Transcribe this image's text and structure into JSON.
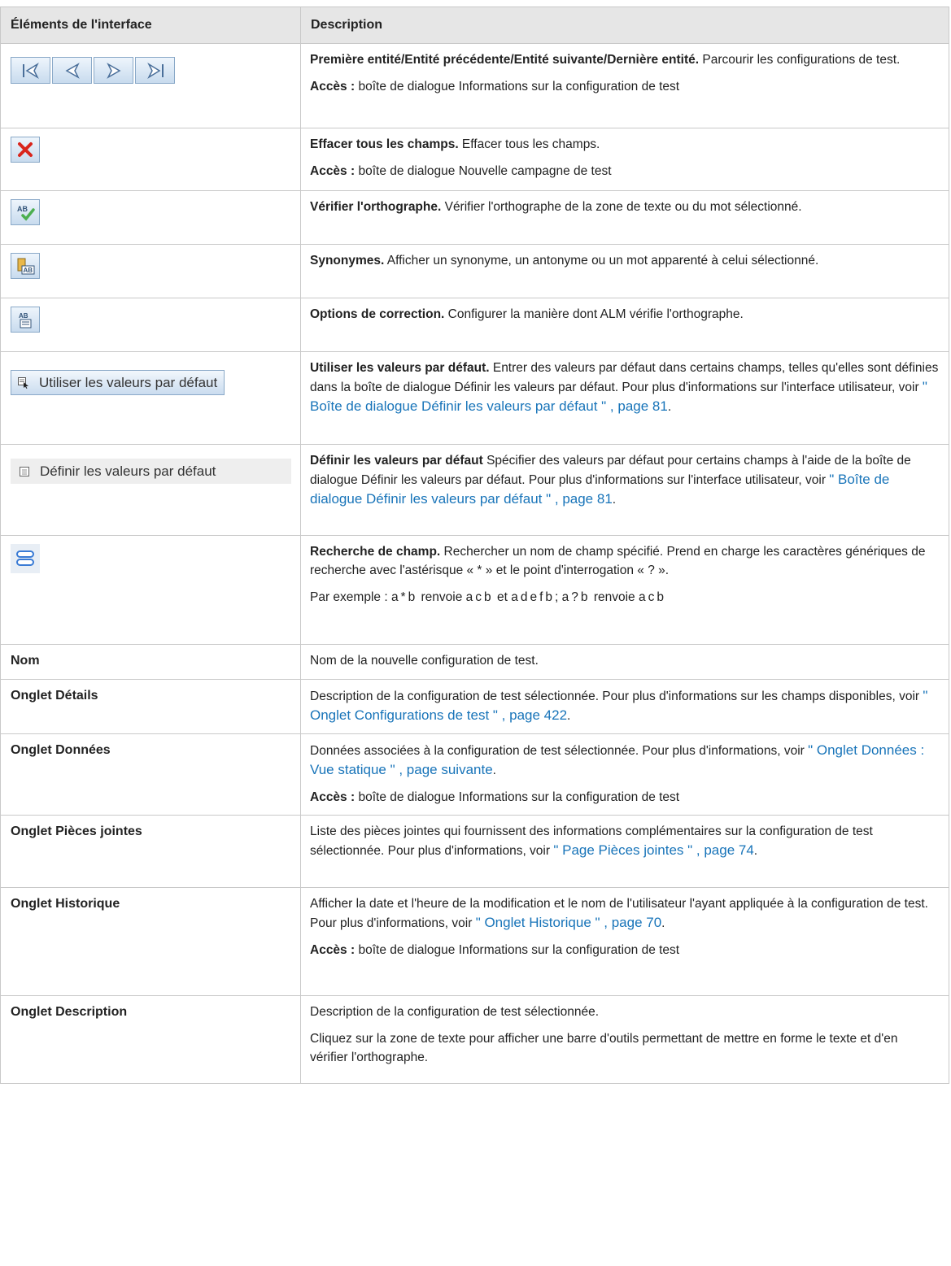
{
  "header": {
    "col1": "Éléments de l'interface",
    "col2": "Description"
  },
  "rows": {
    "nav": {
      "icons": [
        "first-entity-icon",
        "previous-entity-icon",
        "next-entity-icon",
        "last-entity-icon"
      ],
      "title": "Première entité/Entité précédente/Entité suivante/Dernière entité.",
      "text": " Parcourir les configurations de test.",
      "access_label": "Accès :",
      "access_text": " boîte de dialogue Informations sur la configuration de test"
    },
    "clear": {
      "icon": "clear-fields-icon",
      "title": "Effacer tous les champs.",
      "text": " Effacer tous les champs.",
      "access_label": "Accès :",
      "access_text": " boîte de dialogue Nouvelle campagne de test"
    },
    "spell": {
      "icon": "spell-check-icon",
      "title": "Vérifier l'orthographe.",
      "text": " Vérifier l'orthographe de la zone de texte ou du mot sélectionné."
    },
    "thesaurus": {
      "icon": "thesaurus-icon",
      "title": "Synonymes.",
      "text": " Afficher un synonyme, un antonyme ou un mot apparenté à celui sélectionné."
    },
    "spell_options": {
      "icon": "spelling-options-icon",
      "title": "Options de correction.",
      "text": " Configurer la manière dont ALM vérifie l'orthographe."
    },
    "use_defaults": {
      "button_label": "Utiliser les valeurs par défaut",
      "title": "Utiliser les valeurs par défaut.",
      "text": " Entrer des valeurs par défaut dans certains champs, telles qu'elles sont définies dans la boîte de dialogue Définir les valeurs par défaut. Pour plus d'informations sur l'interface utilisateur, voir ",
      "link": "\" Boîte de dialogue Définir les valeurs par défaut \" , page 81",
      "end": "."
    },
    "set_defaults": {
      "button_label": "Définir les valeurs par défaut",
      "title": "Définir les valeurs par défaut",
      "text": " Spécifier des valeurs par défaut pour certains champs à l'aide de la boîte de dialogue Définir les valeurs par défaut. Pour plus d'informations sur l'interface utilisateur, voir ",
      "link": "\" Boîte de dialogue Définir les valeurs par défaut \" , page 81",
      "end": "."
    },
    "field_search": {
      "icon": "field-search-icon",
      "title": "Recherche de champ.",
      "text": " Rechercher un nom de champ spécifié. Prend en charge les caractères génériques de recherche avec l'astérisque « * » et le point d'interrogation « ? ».",
      "example_prefix": "Par exemple : ",
      "ex1": "a*b",
      "ex_mid1": " renvoie ",
      "ex2": "acb",
      "ex_mid2": " et ",
      "ex3": "adefb",
      "ex_mid3": "; ",
      "ex4": "a?b",
      "ex_mid4": " renvoie ",
      "ex5": "acb"
    },
    "name": {
      "label": "Nom",
      "text": "Nom de la nouvelle configuration de test."
    },
    "details": {
      "label": "Onglet Détails",
      "text": "Description de la configuration de test sélectionnée. Pour plus d'informations sur les champs disponibles, voir ",
      "link": "\" Onglet Configurations de test \" , page 422",
      "end": "."
    },
    "data": {
      "label": "Onglet Données",
      "text": "Données associées à la configuration de test sélectionnée. Pour plus d'informations, voir ",
      "link": "\" Onglet Données : Vue statique \" , page suivante",
      "end": ".",
      "access_label": "Accès :",
      "access_text": " boîte de dialogue Informations sur la configuration de test"
    },
    "attachments": {
      "label": "Onglet Pièces jointes",
      "text": "Liste des pièces jointes qui fournissent des informations complémentaires sur la configuration de test sélectionnée. Pour plus d'informations, voir ",
      "link": "\" Page Pièces jointes \" , page 74",
      "end": "."
    },
    "history": {
      "label": "Onglet Historique",
      "text": "Afficher la date et l'heure de la modification et le nom de l'utilisateur l'ayant appliquée à la configuration de test. Pour plus d'informations, voir ",
      "link": "\" Onglet Historique \" , page 70",
      "end": ".",
      "access_label": "Accès :",
      "access_text": " boîte de dialogue Informations sur la configuration de test"
    },
    "description": {
      "label": "Onglet Description",
      "text": "Description de la configuration de test sélectionnée.",
      "text2": "Cliquez sur la zone de texte pour afficher une barre d'outils permettant de mettre en forme le texte et d'en vérifier l'orthographe."
    }
  }
}
